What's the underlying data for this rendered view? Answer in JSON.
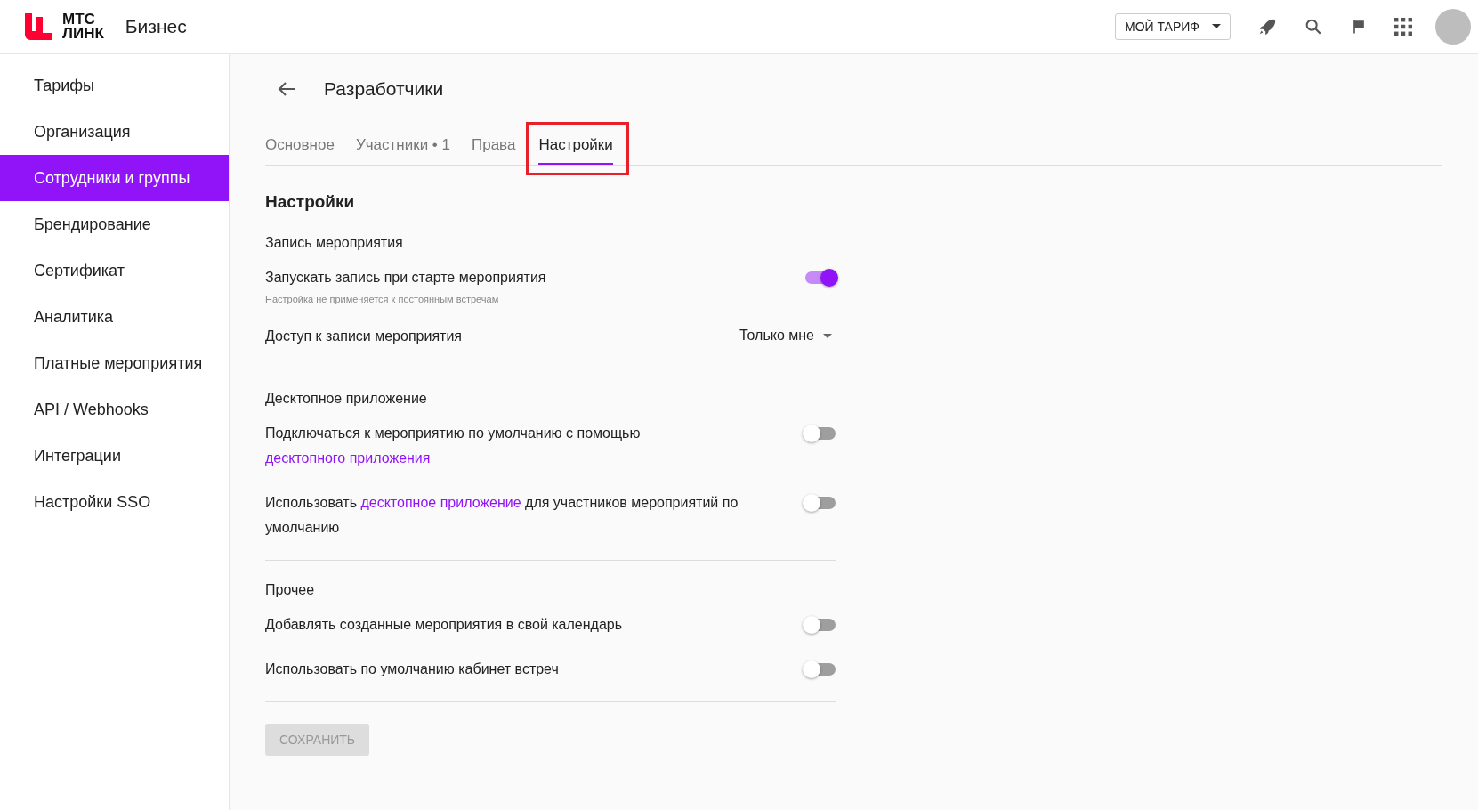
{
  "header": {
    "logo_line_1": "МТС",
    "logo_line_2": "ЛИНК",
    "product": "Бизнес",
    "plan_button": "МОЙ ТАРИФ"
  },
  "sidebar": {
    "items": [
      {
        "label": "Тарифы",
        "selected": false
      },
      {
        "label": "Организация",
        "selected": false
      },
      {
        "label": "Сотрудники и группы",
        "selected": true
      },
      {
        "label": "Брендирование",
        "selected": false
      },
      {
        "label": "Сертификат",
        "selected": false
      },
      {
        "label": "Аналитика",
        "selected": false
      },
      {
        "label": "Платные мероприятия",
        "selected": false
      },
      {
        "label": "API / Webhooks",
        "selected": false
      },
      {
        "label": "Интеграции",
        "selected": false
      },
      {
        "label": "Настройки SSO",
        "selected": false
      }
    ]
  },
  "page": {
    "title": "Разработчики"
  },
  "tabs": [
    {
      "label": "Основное",
      "selected": false,
      "highlighted": false
    },
    {
      "label": "Участники • 1",
      "selected": false,
      "highlighted": false
    },
    {
      "label": "Права",
      "selected": false,
      "highlighted": false
    },
    {
      "label": "Настройки",
      "selected": true,
      "highlighted": true
    }
  ],
  "settings": {
    "title": "Настройки",
    "sections": [
      {
        "title": "Запись мероприятия",
        "rows": [
          {
            "kind": "toggle",
            "parts": [
              {
                "kind": "text",
                "text": "Запускать запись при старте мероприятия"
              }
            ],
            "hint": "Настройка не применяется к постоянным встречам",
            "on": true
          },
          {
            "kind": "select",
            "parts": [
              {
                "kind": "text",
                "text": "Доступ к записи мероприятия"
              }
            ],
            "value": "Только мне"
          }
        ]
      },
      {
        "title": "Десктопное приложение",
        "rows": [
          {
            "kind": "toggle",
            "parts": [
              {
                "kind": "text",
                "text": "Подключаться к мероприятию по умолчанию с помощью "
              },
              {
                "kind": "link",
                "text": "десктопного приложения"
              }
            ],
            "on": false
          },
          {
            "kind": "toggle",
            "parts": [
              {
                "kind": "text",
                "text": "Использовать "
              },
              {
                "kind": "link",
                "text": "десктопное приложение"
              },
              {
                "kind": "text",
                "text": " для участников мероприятий по умолчанию"
              }
            ],
            "on": false
          }
        ]
      },
      {
        "title": "Прочее",
        "rows": [
          {
            "kind": "toggle",
            "parts": [
              {
                "kind": "text",
                "text": "Добавлять созданные мероприятия в свой календарь"
              }
            ],
            "on": false
          },
          {
            "kind": "toggle",
            "parts": [
              {
                "kind": "text",
                "text": "Использовать по умолчанию кабинет встреч"
              }
            ],
            "on": false
          }
        ]
      }
    ],
    "save_button": {
      "label": "СОХРАНИТЬ",
      "disabled": true
    }
  }
}
